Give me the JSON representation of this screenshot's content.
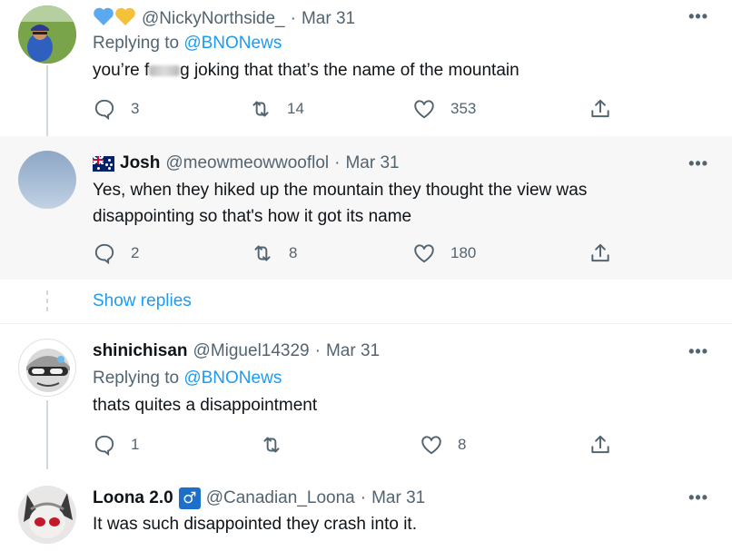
{
  "tweets": [
    {
      "emoji_hearts": [
        "blue-heart",
        "yellow-heart"
      ],
      "name": "",
      "handle": "@NickyNorthside_",
      "date": "Mar 31",
      "replying_label": "Replying to",
      "replying_to": "@BNONews",
      "text_before": "you’re f",
      "text_blurred": "ucki",
      "text_after": "g joking that that’s the name of the mountain",
      "replies": "3",
      "retweets": "14",
      "likes": "353"
    },
    {
      "name": "Josh",
      "flag": "australia-flag",
      "handle": "@meowmeowwooflol",
      "date": "Mar 31",
      "text": "Yes, when they hiked up the mountain they thought the view was disappointing so that's how it got its name",
      "replies": "2",
      "retweets": "8",
      "likes": "180"
    },
    {
      "name": "shinichisan",
      "handle": "@Miguel14329",
      "date": "Mar 31",
      "replying_label": "Replying to",
      "replying_to": "@BNONews",
      "text": "thats quites a disappointment",
      "replies": "1",
      "retweets": "",
      "likes": "8"
    },
    {
      "name": "Loona 2.0",
      "badge": "♂",
      "handle": "@Canadian_Loona",
      "date": "Mar 31",
      "text": "It was such disappointed they crash into it."
    }
  ],
  "separator": "·",
  "more_label": "•••",
  "show_replies": "Show replies",
  "colors": {
    "link": "#1d9bf0",
    "muted": "#536471",
    "highlight_bg": "#f7f7f7",
    "badge": "#1d6fc9"
  }
}
